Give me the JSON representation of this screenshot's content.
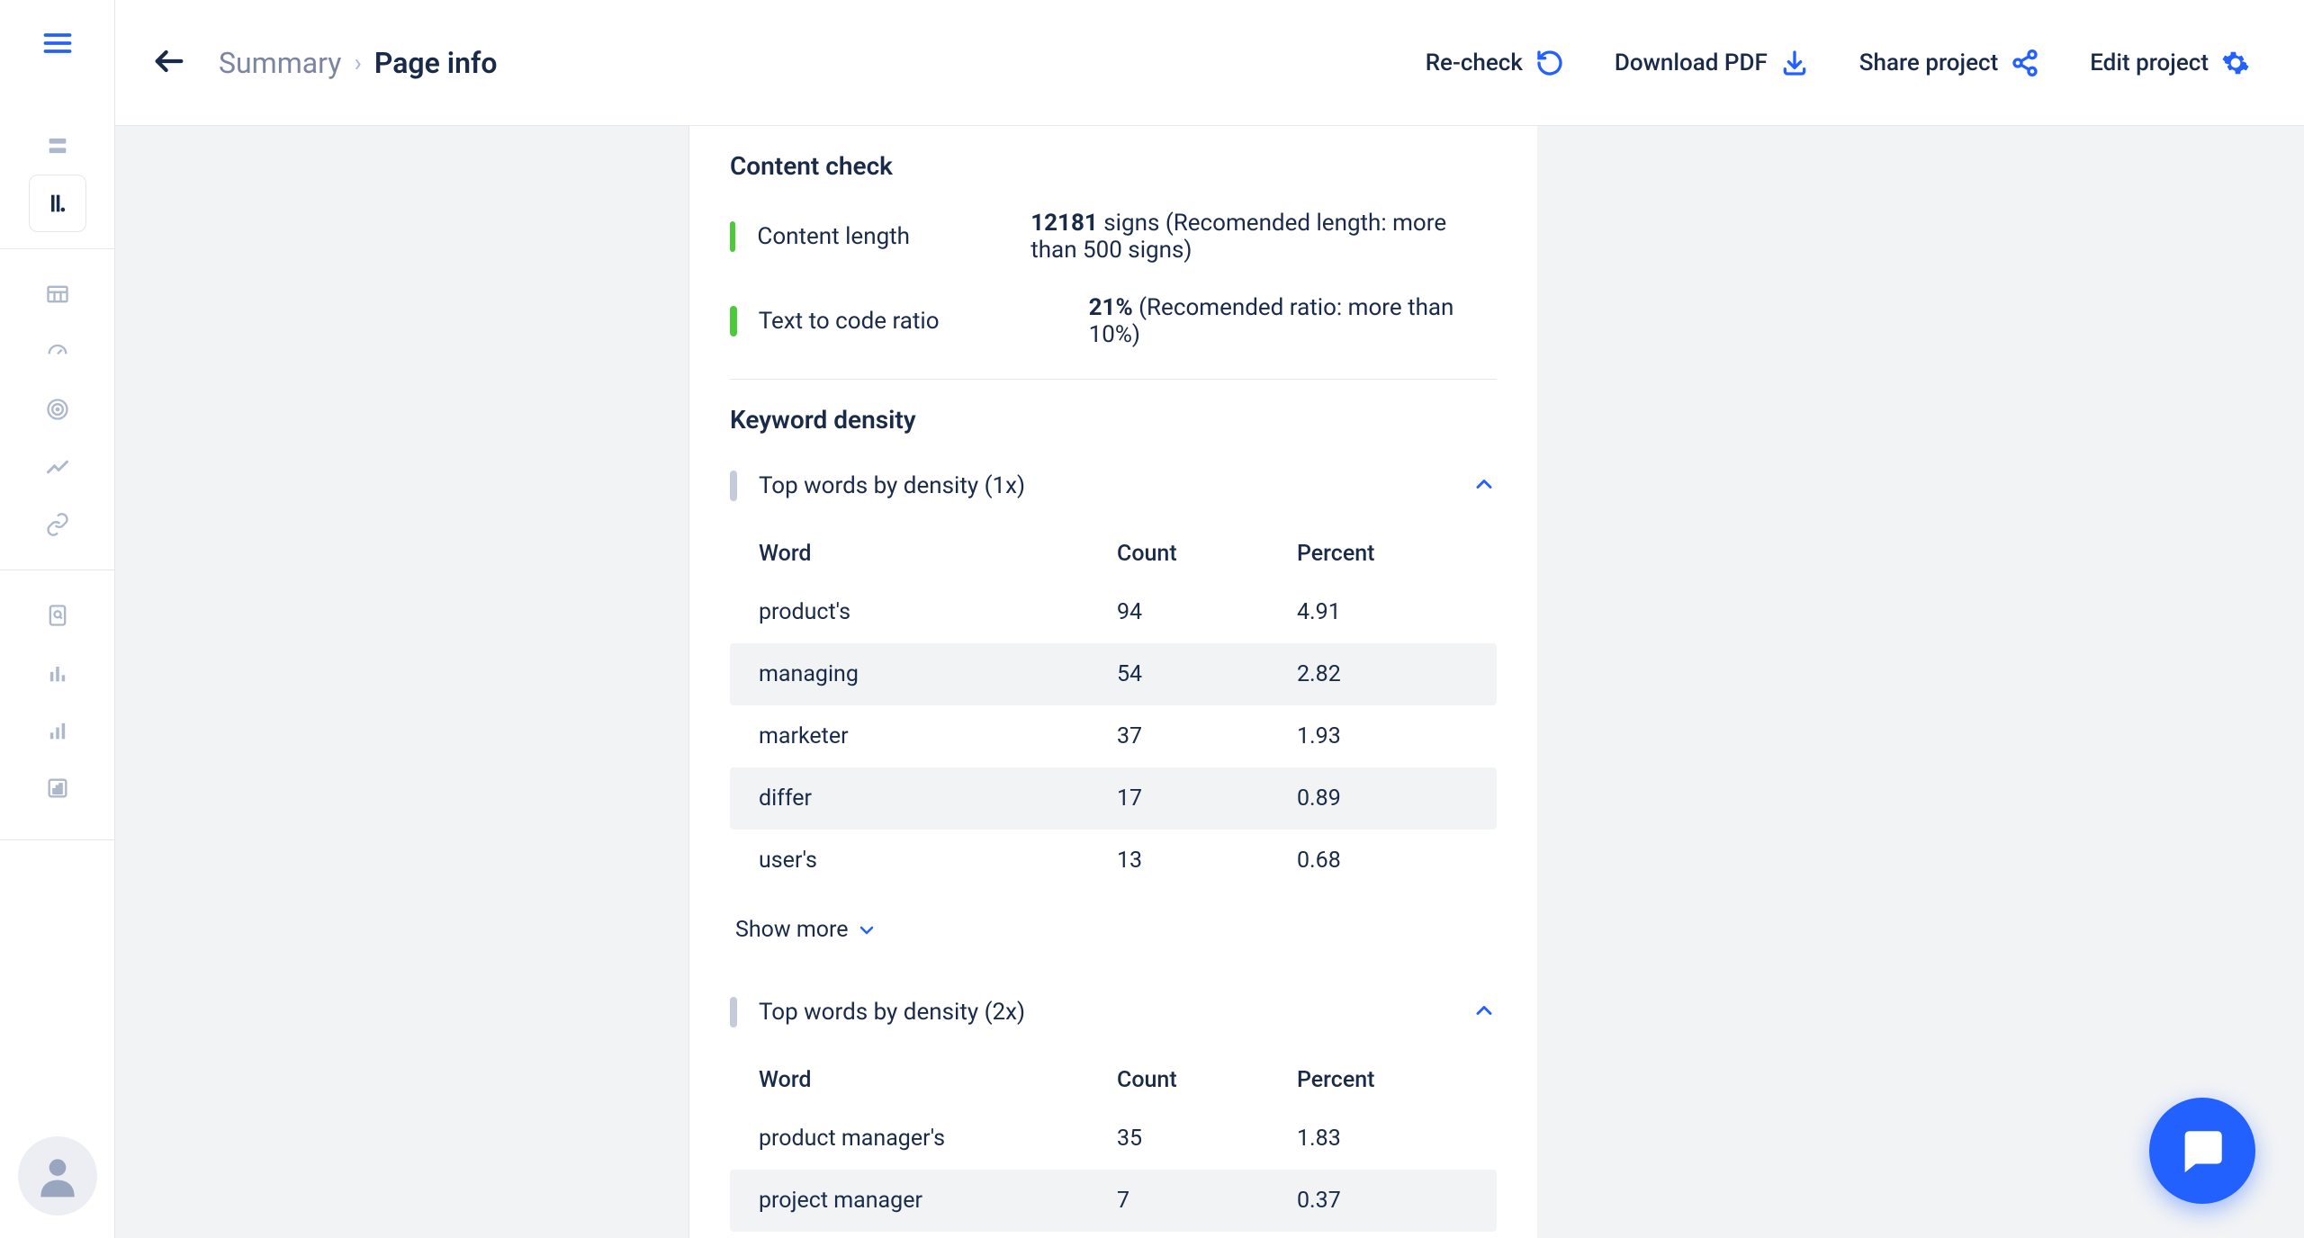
{
  "breadcrumb": {
    "summary": "Summary",
    "current": "Page info"
  },
  "header_actions": {
    "recheck": "Re-check",
    "download_pdf": "Download PDF",
    "share_project": "Share project",
    "edit_project": "Edit project"
  },
  "content_check": {
    "title": "Content check",
    "content_length": {
      "label": "Content length",
      "value": "12181",
      "value_suffix": " signs (Recomended length: more than 500 signs)"
    },
    "text_code_ratio": {
      "label": "Text to code ratio",
      "value": "21%",
      "value_suffix": " (Recomended ratio: more than 10%)"
    }
  },
  "keyword_density": {
    "title": "Keyword density",
    "density_1x": {
      "title": "Top words by density (1x)",
      "columns": {
        "word": "Word",
        "count": "Count",
        "percent": "Percent"
      },
      "rows": [
        {
          "word": "product's",
          "count": "94",
          "percent": "4.91"
        },
        {
          "word": "managing",
          "count": "54",
          "percent": "2.82"
        },
        {
          "word": "marketer",
          "count": "37",
          "percent": "1.93"
        },
        {
          "word": "differ",
          "count": "17",
          "percent": "0.89"
        },
        {
          "word": "user's",
          "count": "13",
          "percent": "0.68"
        }
      ],
      "show_more": "Show more"
    },
    "density_2x": {
      "title": "Top words by density (2x)",
      "columns": {
        "word": "Word",
        "count": "Count",
        "percent": "Percent"
      },
      "rows": [
        {
          "word": "product manager's",
          "count": "35",
          "percent": "1.83"
        },
        {
          "word": "project manager",
          "count": "7",
          "percent": "0.37"
        }
      ]
    }
  },
  "chart_data": [
    {
      "type": "table",
      "title": "Top words by density (1x)",
      "columns": [
        "Word",
        "Count",
        "Percent"
      ],
      "rows": [
        [
          "product's",
          94,
          4.91
        ],
        [
          "managing",
          54,
          2.82
        ],
        [
          "marketer",
          37,
          1.93
        ],
        [
          "differ",
          17,
          0.89
        ],
        [
          "user's",
          13,
          0.68
        ]
      ]
    },
    {
      "type": "table",
      "title": "Top words by density (2x)",
      "columns": [
        "Word",
        "Count",
        "Percent"
      ],
      "rows": [
        [
          "product manager's",
          35,
          1.83
        ],
        [
          "project manager",
          7,
          0.37
        ]
      ]
    }
  ]
}
